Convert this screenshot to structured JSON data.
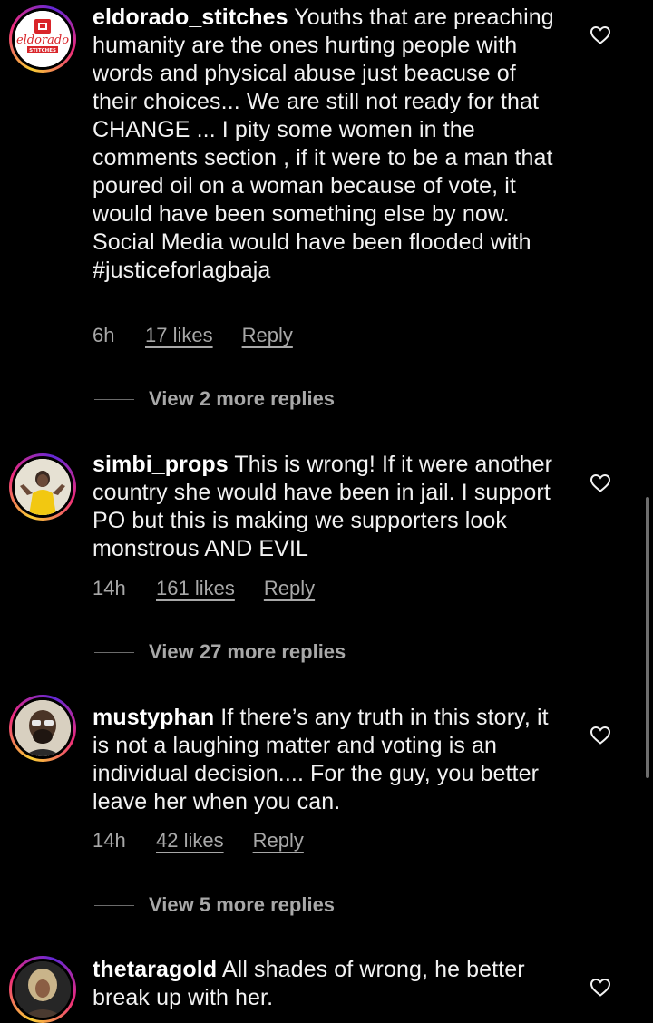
{
  "comments": [
    {
      "username": "eldorado_stitches",
      "text": " Youths that are preaching humanity are the ones hurting people with words and physical abuse just beacuse of their choices... We are still not ready for that CHANGE ... I pity some women in the comments section , if it were to be a man that poured oil on a woman because of vote, it would have been something else by now. Social Media would have been flooded with #justiceforlagbaja",
      "time": "6h",
      "likes": "17 likes",
      "reply": "Reply",
      "view_replies": "View 2 more replies",
      "avatar_text": "eldorado",
      "avatar_subtext": "STITCHES"
    },
    {
      "username": "simbi_props",
      "text": " This is wrong! If it were another country she would have been in jail. I support PO but this is making we supporters look monstrous AND EVIL",
      "time": "14h",
      "likes": "161 likes",
      "reply": "Reply",
      "view_replies": "View 27 more replies"
    },
    {
      "username": "mustyphan",
      "text": " If there’s any truth in this story, it is not a laughing matter and voting is an individual decision.... For the guy, you better leave her when you can.",
      "time": "14h",
      "likes": "42 likes",
      "reply": "Reply",
      "view_replies": "View 5 more replies"
    },
    {
      "username": "thetaragold",
      "text": " All shades of wrong, he better break up with her."
    }
  ],
  "icons": {
    "like": "heart-outline-icon"
  },
  "colors": {
    "background": "#000000",
    "text": "#f2f2f2",
    "secondary": "#a8a8a8",
    "story_ring_start": "#f9ce34",
    "story_ring_mid": "#ee2a7b",
    "story_ring_end": "#6228d7"
  }
}
